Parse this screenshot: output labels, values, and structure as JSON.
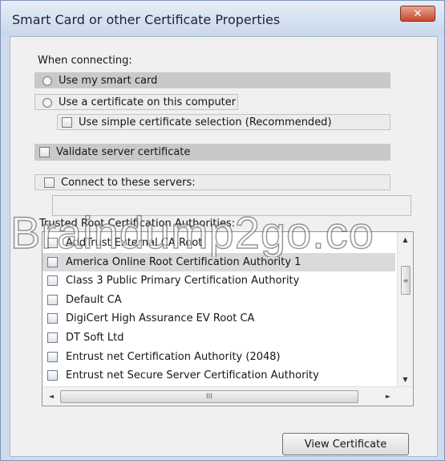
{
  "window": {
    "title": "Smart Card or other Certificate Properties",
    "close_glyph": "✕"
  },
  "connecting": {
    "heading": "When connecting:",
    "use_smart_card": "Use my smart card",
    "use_certificate": "Use a certificate on this computer",
    "simple_selection": "Use simple certificate selection (Recommended)"
  },
  "validate_server": "Validate server certificate",
  "connect_servers": "Connect to these servers:",
  "watermark": "Braindump2go.co",
  "trusted_heading": "Trusted Root Certification Authorities:",
  "authorities": [
    {
      "label": "AddTrust External CA Root",
      "checked": false
    },
    {
      "label": "America Online Root Certification Authority 1",
      "checked": false,
      "selected": true
    },
    {
      "label": "Class 3 Public Primary Certification Authority",
      "checked": false
    },
    {
      "label": "Default CA",
      "checked": false
    },
    {
      "label": "DigiCert High Assurance EV Root CA",
      "checked": false
    },
    {
      "label": "DT Soft Ltd",
      "checked": false
    },
    {
      "label": "Entrust net Certification Authority (2048)",
      "checked": false
    },
    {
      "label": "Entrust net Secure Server Certification Authority",
      "checked": false
    }
  ],
  "scroll_glyphs": {
    "up": "▲",
    "down": "▼",
    "left": "◄",
    "right": "►",
    "v_grip": "≡",
    "h_grip": "III"
  },
  "view_certificate_label": "View Certificate",
  "colors": {
    "title_bar": "#c8d7ea",
    "close_button": "#c8482d",
    "dialog_bg": "#f0f0f0"
  }
}
